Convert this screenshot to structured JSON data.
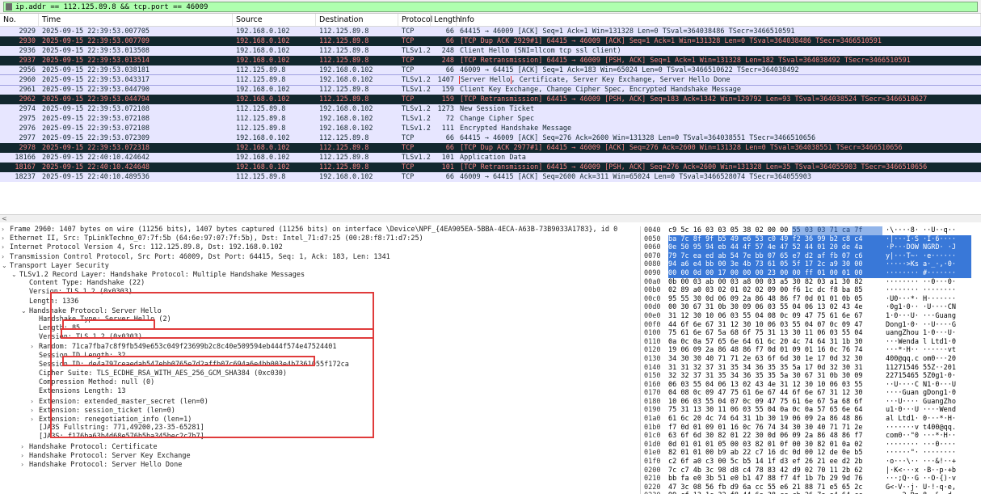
{
  "filter": {
    "value": "ip.addr == 112.125.89.8 && tcp.port == 46009"
  },
  "columns": [
    "No.",
    "Time",
    "Source",
    "Destination",
    "Protocol",
    "Length",
    "Info"
  ],
  "packets": [
    {
      "no": "2929",
      "time": "2025-09-15 22:39:53.007705",
      "src": "192.168.0.102",
      "dst": "112.125.89.8",
      "proto": "TCP",
      "len": "66",
      "info": "64415 → 46009 [ACK] Seq=1 Ack=1 Win=131328 Len=0 TSval=364038486 TSecr=3466510591",
      "style": "light"
    },
    {
      "no": "2930",
      "time": "2025-09-15 22:39:53.007709",
      "src": "192.168.0.102",
      "dst": "112.125.89.8",
      "proto": "TCP",
      "len": "66",
      "info": "[TCP Dup ACK 2929#1] 64415 → 46009 [ACK] Seq=1 Ack=1 Win=131328 Len=0 TSval=364038486 TSecr=3466510591",
      "style": "dark"
    },
    {
      "no": "2936",
      "time": "2025-09-15 22:39:53.013508",
      "src": "192.168.0.102",
      "dst": "112.125.89.8",
      "proto": "TLSv1.2",
      "len": "248",
      "info": "Client Hello (SNI=llcom tcp ssl client)",
      "style": "light"
    },
    {
      "no": "2937",
      "time": "2025-09-15 22:39:53.013514",
      "src": "192.168.0.102",
      "dst": "112.125.89.8",
      "proto": "TCP",
      "len": "248",
      "info": "[TCP Retransmission] 64415 → 46009 [PSH, ACK] Seq=1 Ack=1 Win=131328 Len=182 TSval=364038492 TSecr=3466510591",
      "style": "dark"
    },
    {
      "no": "2956",
      "time": "2025-09-15 22:39:53.038181",
      "src": "112.125.89.8",
      "dst": "192.168.0.102",
      "proto": "TCP",
      "len": "66",
      "info": "46009 → 64415 [ACK] Seq=1 Ack=183 Win=65024 Len=0 TSval=3466510622 TSecr=364038492",
      "style": "light"
    },
    {
      "no": "2960",
      "time": "2025-09-15 22:39:53.043317",
      "src": "112.125.89.8",
      "dst": "192.168.0.102",
      "proto": "TLSv1.2",
      "len": "1407",
      "info_hl": "Server Hello",
      "info_rest": ", Certificate, Server Key Exchange, Server Hello Done",
      "style": "sel"
    },
    {
      "no": "2961",
      "time": "2025-09-15 22:39:53.044790",
      "src": "192.168.0.102",
      "dst": "112.125.89.8",
      "proto": "TLSv1.2",
      "len": "159",
      "info": "Client Key Exchange, Change Cipher Spec, Encrypted Handshake Message",
      "style": "light"
    },
    {
      "no": "2962",
      "time": "2025-09-15 22:39:53.044794",
      "src": "192.168.0.102",
      "dst": "112.125.89.8",
      "proto": "TCP",
      "len": "159",
      "info": "[TCP Retransmission] 64415 → 46009 [PSH, ACK] Seq=183 Ack=1342 Win=129792 Len=93 TSval=364038524 TSecr=3466510627",
      "style": "dark"
    },
    {
      "no": "2974",
      "time": "2025-09-15 22:39:53.072108",
      "src": "112.125.89.8",
      "dst": "192.168.0.102",
      "proto": "TLSv1.2",
      "len": "1273",
      "info": "New Session Ticket",
      "style": "light"
    },
    {
      "no": "2975",
      "time": "2025-09-15 22:39:53.072108",
      "src": "112.125.89.8",
      "dst": "192.168.0.102",
      "proto": "TLSv1.2",
      "len": "72",
      "info": "Change Cipher Spec",
      "style": "light"
    },
    {
      "no": "2976",
      "time": "2025-09-15 22:39:53.072108",
      "src": "112.125.89.8",
      "dst": "192.168.0.102",
      "proto": "TLSv1.2",
      "len": "111",
      "info": "Encrypted Handshake Message",
      "style": "light"
    },
    {
      "no": "2977",
      "time": "2025-09-15 22:39:53.072309",
      "src": "192.168.0.102",
      "dst": "112.125.89.8",
      "proto": "TCP",
      "len": "66",
      "info": "64415 → 46009 [ACK] Seq=276 Ack=2600 Win=131328 Len=0 TSval=364038551 TSecr=3466510656",
      "style": "light"
    },
    {
      "no": "2978",
      "time": "2025-09-15 22:39:53.072318",
      "src": "192.168.0.102",
      "dst": "112.125.89.8",
      "proto": "TCP",
      "len": "66",
      "info": "[TCP Dup ACK 2977#1] 64415 → 46009 [ACK] Seq=276 Ack=2600 Win=131328 Len=0 TSval=364038551 TSecr=3466510656",
      "style": "dark"
    },
    {
      "no": "18166",
      "time": "2025-09-15 22:40:10.424642",
      "src": "192.168.0.102",
      "dst": "112.125.89.8",
      "proto": "TLSv1.2",
      "len": "101",
      "info": "Application Data",
      "style": "light"
    },
    {
      "no": "18167",
      "time": "2025-09-15 22:40:10.424648",
      "src": "192.168.0.102",
      "dst": "112.125.89.8",
      "proto": "TCP",
      "len": "101",
      "info": "[TCP Retransmission] 64415 → 46009 [PSH, ACK] Seq=276 Ack=2600 Win=131328 Len=35 TSval=364055903 TSecr=3466510656",
      "style": "dark"
    },
    {
      "no": "18237",
      "time": "2025-09-15 22:40:10.489536",
      "src": "112.125.89.8",
      "dst": "192.168.0.102",
      "proto": "TCP",
      "len": "66",
      "info": "46009 → 64415 [ACK] Seq=2600 Ack=311 Win=65024 Len=0 TSval=3466528074 TSecr=364055903",
      "style": "light"
    }
  ],
  "details": [
    {
      "arrow": "›",
      "indent": 0,
      "text": "Frame 2960: 1407 bytes on wire (11256 bits), 1407 bytes captured (11256 bits) on interface \\Device\\NPF_{4EA905EA-5BBA-4ECA-A63B-73B9033A1783}, id 0"
    },
    {
      "arrow": "›",
      "indent": 0,
      "text": "Ethernet II, Src: TpLinkTechno_07:7f:5b (64:6e:97:07:7f:5b), Dst: Intel_71:d7:25 (00:28:f8:71:d7:25)"
    },
    {
      "arrow": "›",
      "indent": 0,
      "text": "Internet Protocol Version 4, Src: 112.125.89.8, Dst: 192.168.0.102"
    },
    {
      "arrow": "›",
      "indent": 0,
      "text": "Transmission Control Protocol, Src Port: 46009, Dst Port: 64415, Seq: 1, Ack: 183, Len: 1341"
    },
    {
      "arrow": "⌄",
      "indent": 0,
      "text": "Transport Layer Security"
    },
    {
      "arrow": "⌄",
      "indent": 1,
      "text": "TLSv1.2 Record Layer: Handshake Protocol: Multiple Handshake Messages"
    },
    {
      "arrow": "",
      "indent": 2,
      "text": "Content Type: Handshake (22)"
    },
    {
      "arrow": "",
      "indent": 2,
      "text": "Version: TLS 1.2 (0x0303)"
    },
    {
      "arrow": "",
      "indent": 2,
      "text": "Length: 1336"
    },
    {
      "arrow": "⌄",
      "indent": 2,
      "text": "Handshake Protocol: Server Hello"
    },
    {
      "arrow": "",
      "indent": 3,
      "text": "Handshake Type: Server Hello (2)"
    },
    {
      "arrow": "",
      "indent": 3,
      "text": "Length: 85"
    },
    {
      "arrow": "",
      "indent": 3,
      "text": "Version: TLS 1.2 (0x0303)"
    },
    {
      "arrow": "›",
      "indent": 3,
      "text": "Random: 71ca7fba7c8f9fb549e653c049f23699b2c8c40e509594eb444f574e47524401"
    },
    {
      "arrow": "",
      "indent": 3,
      "text": "Session ID Length: 32"
    },
    {
      "arrow": "",
      "indent": 3,
      "text": "Session ID: de4a797ceaedab547ebb0765e7d2affb07c694a6e4bb003e4b7361055f172ca"
    },
    {
      "arrow": "",
      "indent": 3,
      "text": "Cipher Suite: TLS_ECDHE_RSA_WITH_AES_256_GCM_SHA384 (0xc030)"
    },
    {
      "arrow": "",
      "indent": 3,
      "text": "Compression Method: null (0)"
    },
    {
      "arrow": "",
      "indent": 3,
      "text": "Extensions Length: 13"
    },
    {
      "arrow": "›",
      "indent": 3,
      "text": "Extension: extended_master_secret (len=0)"
    },
    {
      "arrow": "›",
      "indent": 3,
      "text": "Extension: session_ticket (len=0)"
    },
    {
      "arrow": "›",
      "indent": 3,
      "text": "Extension: renegotiation_info (len=1)"
    },
    {
      "arrow": "",
      "indent": 3,
      "text": "[JA3S Fullstring: 771,49200,23-35-65281]"
    },
    {
      "arrow": "",
      "indent": 3,
      "text": "[JA3S: f176ba63b4d68e576b5ba345bec2c7b7]"
    },
    {
      "arrow": "›",
      "indent": 2,
      "text": "Handshake Protocol: Certificate"
    },
    {
      "arrow": "›",
      "indent": 2,
      "text": "Handshake Protocol: Server Key Exchange"
    },
    {
      "arrow": "›",
      "indent": 2,
      "text": "Handshake Protocol: Server Hello Done"
    }
  ],
  "bytes": [
    {
      "off": "0040",
      "hex": "c9 5c 16 03 03 05 38 02  00 00 55 03 03 71 ca 7f",
      "asc": "·\\····8· ··U··q··",
      "sel_from": 7
    },
    {
      "off": "0050",
      "hex": "ba 7c 8f 9f b5 49 e6 53  c0 49 f2 36 99 b2 c8 c4",
      "asc": "·|···I·S ·I·6····",
      "sel_from": 0
    },
    {
      "off": "0060",
      "hex": "0e 50 95 94 eb 44 4f 57  4e 47 52 44 01 20 de 4a",
      "asc": "·P···DOW NGRD· ·J",
      "sel_from": 0
    },
    {
      "off": "0070",
      "hex": "79 7c ea ed ab 54 7e bb  07 65 e7 d2 af fb 07 c6",
      "asc": "y|···T~· ·e······",
      "sel_from": 0
    },
    {
      "off": "0080",
      "hex": "94 a6 e4 bb 00 3e 4b 73  61 05 5f 17 2c a9 30 00",
      "asc": "·····>Ks a·_·,·0·",
      "sel_from": 0
    },
    {
      "off": "0090",
      "hex": "00 00 0d 00 17 00 00 00  23 00 00 ff 01 00 01 00",
      "asc": "········ #·······",
      "sel_from": 0
    },
    {
      "off": "00a0",
      "hex": "0b 00 03 ab 00 03 a8 00  03 a5 30 82 03 a1 30 82",
      "asc": "········ ··0···0·",
      "sel_from": -1
    },
    {
      "off": "00b0",
      "hex": "02 89 a0 03 02 01 02 02  09 00 f6 1c dc f8 ba 85",
      "asc": "········ ········",
      "sel_from": -1
    },
    {
      "off": "00c0",
      "hex": "95 55 30 0d 06 09 2a 86  48 86 f7 0d 01 01 0b 05",
      "asc": "·U0···*· H·······",
      "sel_from": -1
    },
    {
      "off": "00d0",
      "hex": "00 30 67 31 0b 30 09 06  03 55 04 06 13 02 43 4e",
      "asc": "·0g1·0·· ·U····CN",
      "sel_from": -1
    },
    {
      "off": "00e0",
      "hex": "31 12 30 10 06 03 55 04  08 0c 09 47 75 61 6e 67",
      "asc": "1·0···U· ···Guang",
      "sel_from": -1
    },
    {
      "off": "00f0",
      "hex": "44 6f 6e 67 31 12 30 10  06 03 55 04 07 0c 09 47",
      "asc": "Dong1·0· ··U····G",
      "sel_from": -1
    },
    {
      "off": "0100",
      "hex": "75 61 6e 67 5a 68 6f 75  31 13 30 11 06 03 55 04",
      "asc": "uangZhou 1·0···U·",
      "sel_from": -1
    },
    {
      "off": "0110",
      "hex": "0a 0c 0a 57 65 6e 64 61  6c 20 4c 74 64 31 1b 30",
      "asc": "···Wenda l Ltd1·0",
      "sel_from": -1
    },
    {
      "off": "0120",
      "hex": "19 06 09 2a 86 48 86 f7  0d 01 09 01 16 0c 76 74",
      "asc": "···*·H·· ······vt",
      "sel_from": -1
    },
    {
      "off": "0130",
      "hex": "34 30 30 40 71 71 2e 63  6f 6d 30 1e 17 0d 32 30",
      "asc": "400@qq.c om0···20",
      "sel_from": -1
    },
    {
      "off": "0140",
      "hex": "31 31 32 37 31 35 34 36  35 35 5a 17 0d 32 30 31",
      "asc": "11271546 55Z··201",
      "sel_from": -1
    },
    {
      "off": "0150",
      "hex": "32 32 37 31 35 34 36 35  35 5a 30 67 31 0b 30 09",
      "asc": "22715465 5Z0g1·0·",
      "sel_from": -1
    },
    {
      "off": "0160",
      "hex": "06 03 55 04 06 13 02 43  4e 31 12 30 10 06 03 55",
      "asc": "··U····C N1·0···U",
      "sel_from": -1
    },
    {
      "off": "0170",
      "hex": "04 08 0c 09 47 75 61 6e  67 44 6f 6e 67 31 12 30",
      "asc": "····Guan gDong1·0",
      "sel_from": -1
    },
    {
      "off": "0180",
      "hex": "10 06 03 55 04 07 0c 09  47 75 61 6e 67 5a 68 6f",
      "asc": "···U···· GuangZho",
      "sel_from": -1
    },
    {
      "off": "0190",
      "hex": "75 31 13 30 11 06 03 55  04 0a 0c 0a 57 65 6e 64",
      "asc": "u1·0···U ····Wend",
      "sel_from": -1
    },
    {
      "off": "01a0",
      "hex": "61 6c 20 4c 74 64 31 1b  30 19 06 09 2a 86 48 86",
      "asc": "al Ltd1· 0···*·H·",
      "sel_from": -1
    },
    {
      "off": "01b0",
      "hex": "f7 0d 01 09 01 16 0c 76  74 34 30 30 40 71 71 2e",
      "asc": "·······v t400@qq.",
      "sel_from": -1
    },
    {
      "off": "01c0",
      "hex": "63 6f 6d 30 82 01 22 30  0d 06 09 2a 86 48 86 f7",
      "asc": "com0··\"0 ···*·H··",
      "sel_from": -1
    },
    {
      "off": "01d0",
      "hex": "0d 01 01 01 05 00 03 82  01 0f 00 30 82 01 0a 02",
      "asc": "········ ···0····",
      "sel_from": -1
    },
    {
      "off": "01e0",
      "hex": "82 01 01 00 b9 ab 22 c7  16 dc 0d 00 12 de 0e b5",
      "asc": "······\"· ········",
      "sel_from": -1
    },
    {
      "off": "01f0",
      "hex": "c2 6f a0 c3 00 5c b5 14  1f d3 ef 26 21 ee d2 2b",
      "asc": "·o···\\·· ···&!··+",
      "sel_from": -1
    },
    {
      "off": "0200",
      "hex": "7c c7 4b 3c 98 d8 c4 78  83 42 d9 02 70 11 2b 62",
      "asc": "|·K<···x ·B··p·+b",
      "sel_from": -1
    },
    {
      "off": "0210",
      "hex": "bb fa e0 3b 51 e0 b1 47  88 f7 4f 1b 7b 29 9d 76",
      "asc": "···;Q··G ··O·{)·v",
      "sel_from": -1
    },
    {
      "off": "0220",
      "hex": "47 3c 08 56 fb d9 6a cc  55 e6 21 88 71 e5 65 2c",
      "asc": "G<·V··j· U·!·q·e,",
      "sel_from": -1
    },
    {
      "off": "0230",
      "hex": "99 cf 13 1c 32 f8 44 6e  38 cc cb 26 7e e4 64 cc",
      "asc": "····2·Dn 8··&~·d·",
      "sel_from": -1
    }
  ]
}
